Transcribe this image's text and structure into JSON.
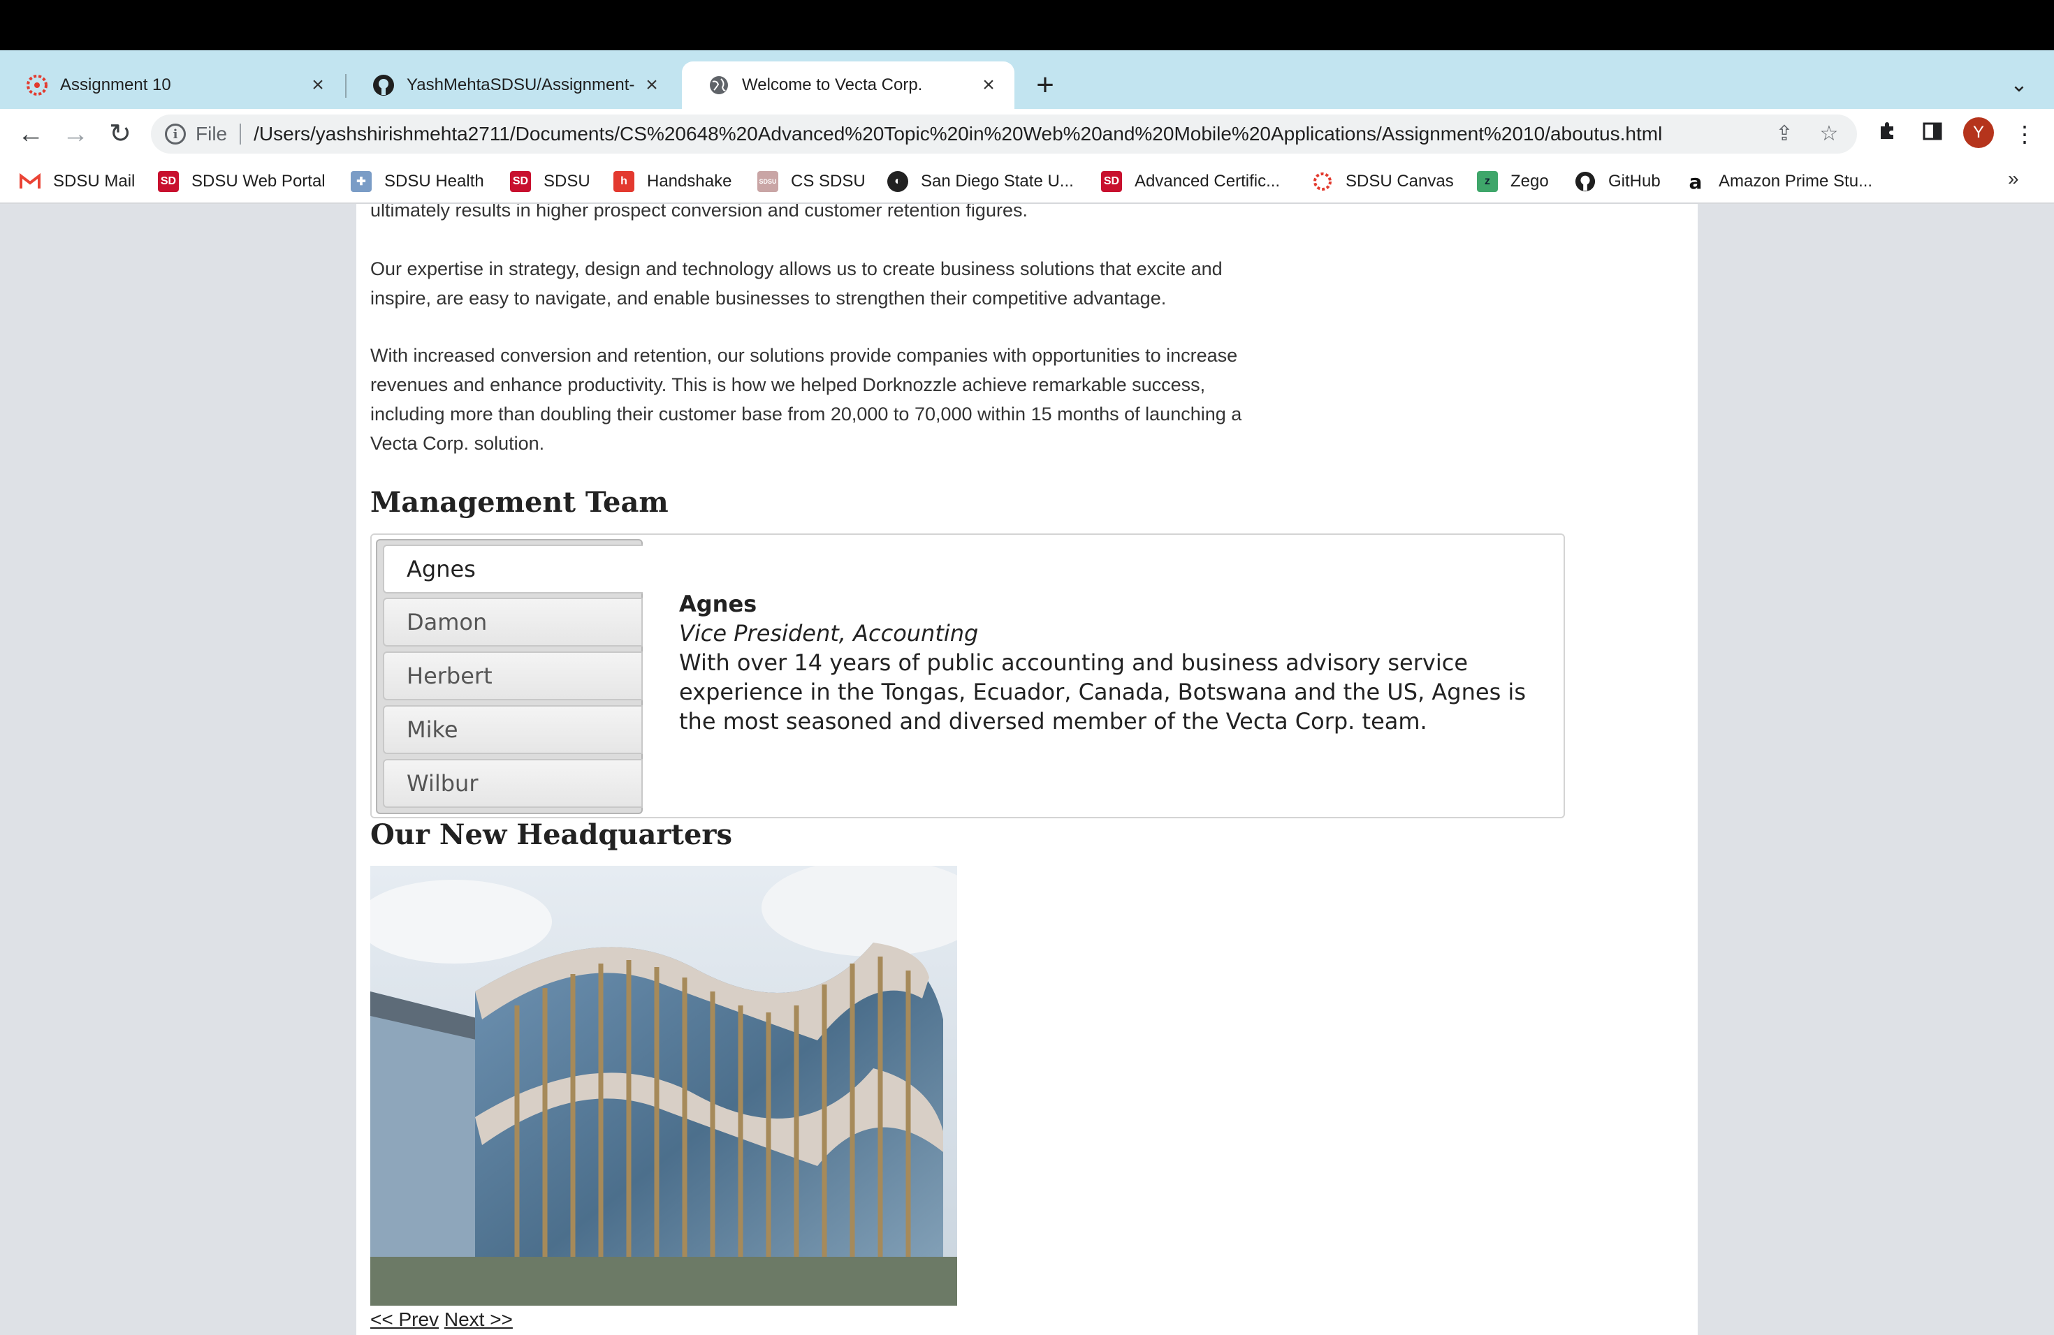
{
  "browser": {
    "tabs": [
      {
        "title": "Assignment 10",
        "icon": "canvas-icon"
      },
      {
        "title": "YashMehtaSDSU/Assignment-",
        "icon": "github-icon"
      },
      {
        "title": "Welcome to Vecta Corp.",
        "icon": "globe-icon",
        "active": true
      }
    ],
    "address": {
      "scheme": "File",
      "url": "/Users/yashshirishmehta2711/Documents/CS%20648%20Advanced%20Topic%20in%20Web%20and%20Mobile%20Applications/Assignment%2010/aboutus.html"
    },
    "avatar_letter": "Y",
    "bookmarks": [
      {
        "label": "SDSU Mail",
        "icon": "gmail-icon"
      },
      {
        "label": "SDSU Web Portal",
        "icon": "sdsu-icon"
      },
      {
        "label": "SDSU Health",
        "icon": "health-icon"
      },
      {
        "label": "SDSU",
        "icon": "sdsu-icon"
      },
      {
        "label": "Handshake",
        "icon": "handshake-icon"
      },
      {
        "label": "CS SDSU",
        "icon": "cs-icon"
      },
      {
        "label": "San Diego State U...",
        "icon": "globe-icon"
      },
      {
        "label": "Advanced Certific...",
        "icon": "sdsu-icon"
      },
      {
        "label": "SDSU Canvas",
        "icon": "canvas-icon"
      },
      {
        "label": "Zego",
        "icon": "zego-icon"
      },
      {
        "label": "GitHub",
        "icon": "github-icon"
      },
      {
        "label": "Amazon Prime Stu...",
        "icon": "amazon-icon"
      }
    ],
    "more": "»"
  },
  "page": {
    "intro_partial": "ultimately results in higher prospect conversion and customer retention figures.",
    "para_expertise": "Our expertise in strategy, design and technology allows us to create business solutions that excite and inspire, are easy to navigate, and enable businesses to strengthen their competitive advantage.",
    "para_conversion": "With increased conversion and retention, our solutions provide companies with opportunities to increase revenues and enhance productivity. This is how we helped Dorknozzle achieve remarkable success, including more than doubling their customer base from 20,000 to 70,000 within 15 months of launching a Vecta Corp. solution.",
    "management_heading": "Management Team",
    "team_tabs": [
      "Agnes",
      "Damon",
      "Herbert",
      "Mike",
      "Wilbur"
    ],
    "selected": {
      "name": "Agnes",
      "role": "Vice President, Accounting",
      "bio": "With over 14 years of public accounting and business advisory service experience in the Tongas, Ecuador, Canada, Botswana and the US, Agnes is the most seasoned and diversed member of the Vecta Corp. team."
    },
    "hq_heading": "Our New Headquarters",
    "prev_label": "<< Prev",
    "next_label": "Next >>"
  },
  "colors": {
    "tabstrip": "#c2e4f0",
    "page_bg": "#dee1e6",
    "avatar": "#b5341c"
  }
}
